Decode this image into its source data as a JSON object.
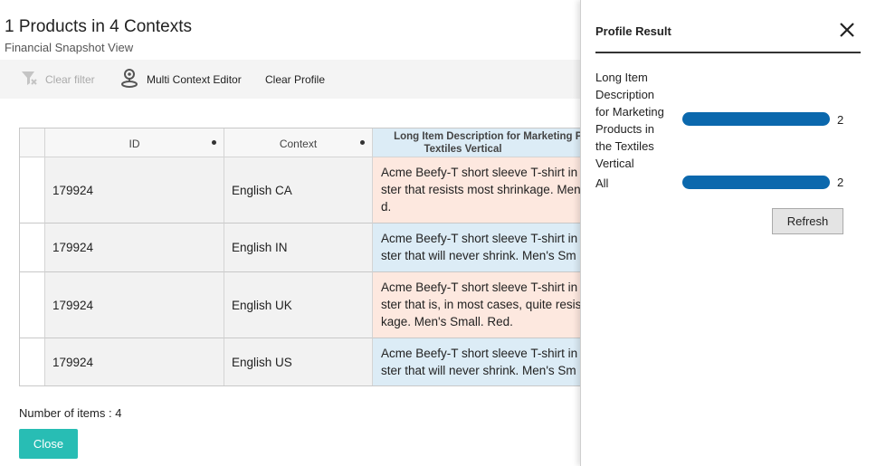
{
  "header": {
    "title": "1 Products in 4 Contexts",
    "subtitle": "Financial Snapshot View"
  },
  "toolbar": {
    "clear_filter": "Clear filter",
    "multi_context_editor": "Multi Context Editor",
    "clear_profile": "Clear Profile"
  },
  "table": {
    "columns": {
      "id": "ID",
      "context": "Context",
      "long_desc_line1": "Long Item Description for Marketing Pr",
      "long_desc_line2": "Textiles Vertical"
    },
    "rows": [
      {
        "id": "179924",
        "context": "English CA",
        "desc": [
          "Acme Beefy-T short sleeve T-shirt in",
          "ster that resists most shrinkage. Men",
          "d."
        ]
      },
      {
        "id": "179924",
        "context": "English IN",
        "desc": [
          "Acme Beefy-T short sleeve T-shirt in",
          "ster that will never shrink. Men's Sm"
        ]
      },
      {
        "id": "179924",
        "context": "English UK",
        "desc": [
          "Acme Beefy-T short sleeve T-shirt in",
          "ster that is, in most cases, quite resis",
          "kage. Men's Small. Red."
        ]
      },
      {
        "id": "179924",
        "context": "English US",
        "desc": [
          "Acme Beefy-T short sleeve T-shirt in",
          "ster that will never shrink. Men's Sm"
        ]
      }
    ]
  },
  "footer": {
    "count": "Number of items : 4",
    "close": "Close"
  },
  "panel": {
    "title": "Profile Result",
    "items": [
      {
        "label": [
          "Long Item",
          "Description",
          "for Marketing",
          "Products in",
          "the Textiles",
          "Vertical"
        ],
        "value": "2"
      },
      {
        "label": [
          "All"
        ],
        "value": "2"
      }
    ],
    "refresh": "Refresh"
  },
  "colors": {
    "accent": "#28bdb4",
    "bar": "#0b68ad",
    "peach_row": "#fde8df",
    "blue_row": "#dcecf6"
  }
}
